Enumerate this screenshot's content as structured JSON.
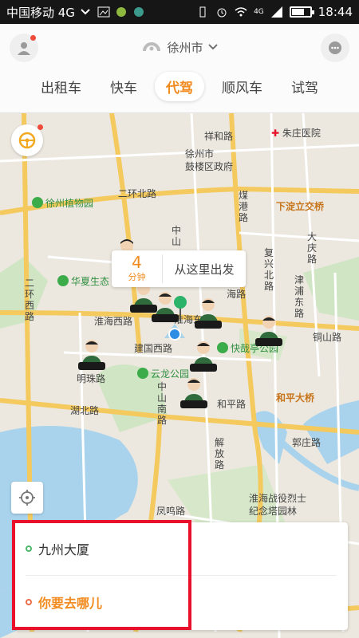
{
  "status_bar": {
    "carrier": "中国移动 4G",
    "network": "4G",
    "time": "18:44"
  },
  "header": {
    "city": "徐州市",
    "tabs": [
      {
        "label": "出租车",
        "active": false
      },
      {
        "label": "快车",
        "active": false
      },
      {
        "label": "代驾",
        "active": true
      },
      {
        "label": "顺风车",
        "active": false
      },
      {
        "label": "试驾",
        "active": false
      }
    ]
  },
  "map": {
    "eta_number": "4",
    "eta_unit": "分钟",
    "pickup_prompt": "从这里出发",
    "roads": {
      "xianghe": "祥和路",
      "erhuan_bei": "二环北路",
      "zhongshan": "中山",
      "meigang": "煤港路",
      "fuxing_bei": "复兴北路",
      "daqing": "大庆路",
      "jinpu_dong": "津浦东路",
      "erhuan_xi": "二环西路",
      "huaihai_xi": "淮海西路",
      "huaihai_dong": "淮海东",
      "jianguo_xi": "建国西路",
      "tongshan": "铜山路",
      "hubei": "湖北路",
      "zhongshan_nan": "中山南路",
      "heping": "和平路",
      "jiefang": "解放路",
      "guozhuang": "郭庄路",
      "fengming": "凤鸣路",
      "huaihai_ro": "海路"
    },
    "pois": {
      "zhuzhuang_hospital": "朱庄医院",
      "gulou_gov_1": "徐州市",
      "gulou_gov_2": "鼓楼区政府",
      "botanical_garden": "徐州植物园",
      "xiadian_interchange": "下淀立交桥",
      "huaxia_eco": "华夏生态",
      "mingzhu_road": "明珠路",
      "kuaizaiting_park": "快哉亭公园",
      "yunlong_park": "云龙公园",
      "heping_bridge": "和平大桥",
      "huaihai_cemetery_1": "淮海战役烈士",
      "huaihai_cemetery_2": "纪念塔园林"
    }
  },
  "trip": {
    "origin": "九州大厦",
    "destination": "你要去哪儿"
  },
  "colors": {
    "accent": "#f28b1f",
    "highlight": "#e8102a"
  }
}
